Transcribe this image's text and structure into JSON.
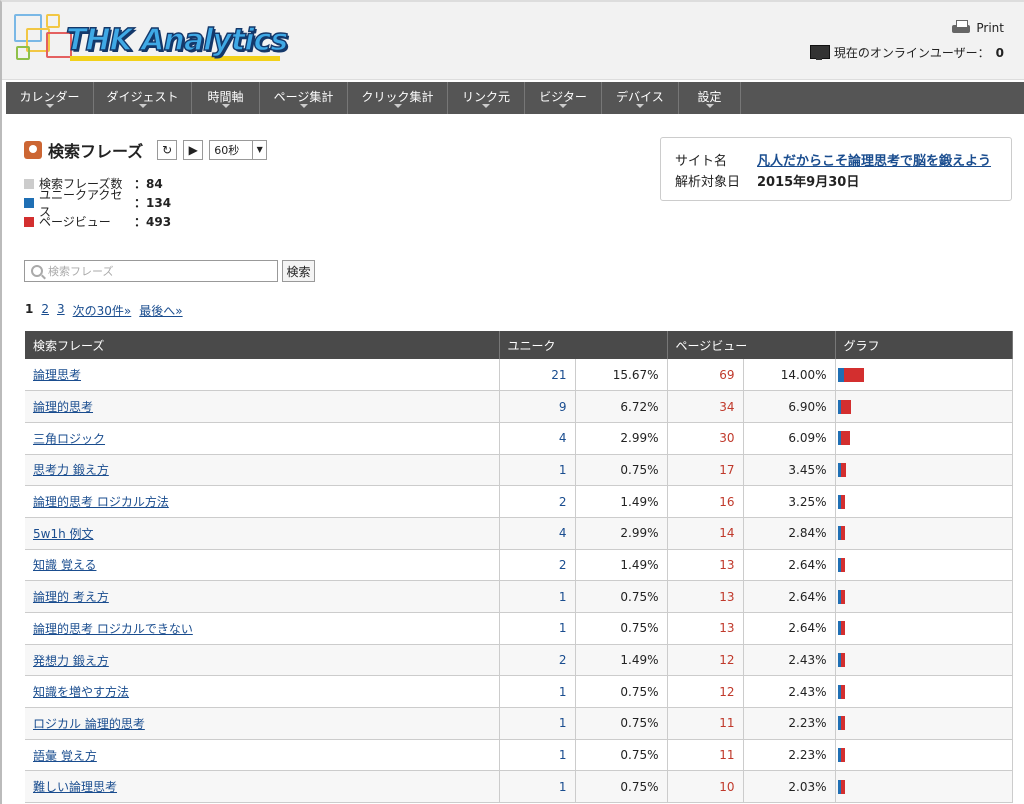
{
  "app": {
    "logo_text": "THK Analytics",
    "print_label": "Print",
    "online_label": "現在のオンラインユーザー：",
    "online_count": "0"
  },
  "nav": [
    {
      "label": "カレンダー"
    },
    {
      "label": "ダイジェスト"
    },
    {
      "label": "時間軸"
    },
    {
      "label": "ページ集計"
    },
    {
      "label": "クリック集計"
    },
    {
      "label": "リンク元"
    },
    {
      "label": "ビジター"
    },
    {
      "label": "デバイス"
    },
    {
      "label": "設定"
    }
  ],
  "summary": {
    "title": "検索フレーズ",
    "interval": "60秒",
    "stats": [
      {
        "label": "検索フレーズ数",
        "value": "：84",
        "color": "#cccccc"
      },
      {
        "label": "ユニークアクセス",
        "value": "：134",
        "color": "#1f6fb4"
      },
      {
        "label": "ページビュー",
        "value": "：493",
        "color": "#d32f2f"
      }
    ]
  },
  "site": {
    "name_label": "サイト名",
    "name_value": "凡人だからこそ論理思考で脳を鍛えよう",
    "date_label": "解析対象日",
    "date_value": "2015年9月30日"
  },
  "search": {
    "placeholder": "検索フレーズ",
    "button": "検索"
  },
  "pager": {
    "current": "1",
    "pages": [
      "2",
      "3"
    ],
    "next": "次の30件»",
    "last": "最後へ»"
  },
  "table": {
    "headers": {
      "phrase": "検索フレーズ",
      "unique": "ユニーク",
      "pageview": "ページビュー",
      "graph": "グラフ"
    },
    "rows": [
      {
        "phrase": "論理思考",
        "u": "21",
        "up": "15.67%",
        "pv": "69",
        "pp": "14.00%",
        "u_val": 21,
        "pv_val": 69
      },
      {
        "phrase": "論理的思考",
        "u": "9",
        "up": "6.72%",
        "pv": "34",
        "pp": "6.90%",
        "u_val": 9,
        "pv_val": 34
      },
      {
        "phrase": "三角ロジック",
        "u": "4",
        "up": "2.99%",
        "pv": "30",
        "pp": "6.09%",
        "u_val": 4,
        "pv_val": 30
      },
      {
        "phrase": "思考力 鍛え方",
        "u": "1",
        "up": "0.75%",
        "pv": "17",
        "pp": "3.45%",
        "u_val": 1,
        "pv_val": 17
      },
      {
        "phrase": "論理的思考 ロジカル方法",
        "u": "2",
        "up": "1.49%",
        "pv": "16",
        "pp": "3.25%",
        "u_val": 2,
        "pv_val": 16
      },
      {
        "phrase": "5w1h 例文",
        "u": "4",
        "up": "2.99%",
        "pv": "14",
        "pp": "2.84%",
        "u_val": 4,
        "pv_val": 14
      },
      {
        "phrase": "知識 覚える",
        "u": "2",
        "up": "1.49%",
        "pv": "13",
        "pp": "2.64%",
        "u_val": 2,
        "pv_val": 13
      },
      {
        "phrase": "論理的 考え方",
        "u": "1",
        "up": "0.75%",
        "pv": "13",
        "pp": "2.64%",
        "u_val": 1,
        "pv_val": 13
      },
      {
        "phrase": "論理的思考 ロジカルできない",
        "u": "1",
        "up": "0.75%",
        "pv": "13",
        "pp": "2.64%",
        "u_val": 1,
        "pv_val": 13
      },
      {
        "phrase": "発想力 鍛え方",
        "u": "2",
        "up": "1.49%",
        "pv": "12",
        "pp": "2.43%",
        "u_val": 2,
        "pv_val": 12
      },
      {
        "phrase": "知識を増やす方法",
        "u": "1",
        "up": "0.75%",
        "pv": "12",
        "pp": "2.43%",
        "u_val": 1,
        "pv_val": 12
      },
      {
        "phrase": "ロジカル 論理的思考",
        "u": "1",
        "up": "0.75%",
        "pv": "11",
        "pp": "2.23%",
        "u_val": 1,
        "pv_val": 11
      },
      {
        "phrase": "語彙 覚え方",
        "u": "1",
        "up": "0.75%",
        "pv": "11",
        "pp": "2.23%",
        "u_val": 1,
        "pv_val": 11
      },
      {
        "phrase": "難しい論理思考",
        "u": "1",
        "up": "0.75%",
        "pv": "10",
        "pp": "2.03%",
        "u_val": 1,
        "pv_val": 10
      }
    ]
  }
}
